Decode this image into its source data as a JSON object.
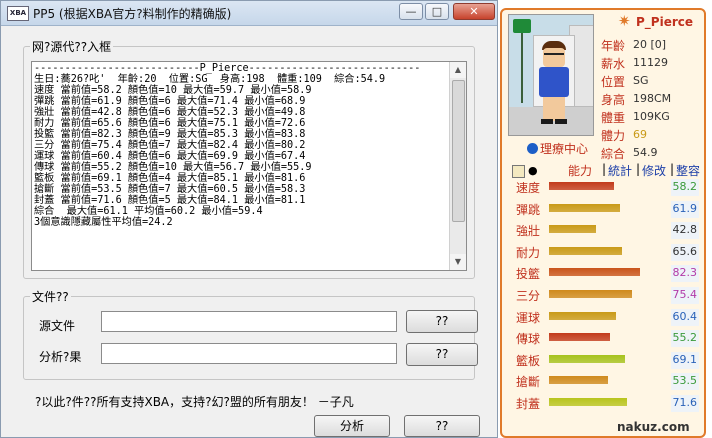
{
  "window": {
    "app_icon": "XBA",
    "title": "PP5 (根据XBA官方?料制作的精确版)",
    "min": "—",
    "max": "□",
    "close": "✕"
  },
  "source_group": {
    "legend": "网?源代??入框",
    "lines": [
      "---------------------------P_Pierce----------------------------",
      "生日:蕎26?叱'  年齡:20  位置:SG  身高:198  體重:109  綜合:54.9",
      "速度 當前值=58.2 顏色值=10 最大值=59.7 最小值=58.9",
      "彈跳 當前值=61.9 顏色值=6 最大值=71.4 最小值=68.9",
      "強壯 當前值=42.8 顏色值=6 最大值=52.3 最小值=49.8",
      "耐力 當前值=65.6 顏色值=6 最大值=75.1 最小值=72.6",
      "投籃 當前值=82.3 顏色值=9 最大值=85.3 最小值=83.8",
      "三分 當前值=75.4 顏色值=7 最大值=82.4 最小值=80.2",
      "運球 當前值=60.4 顏色值=6 最大值=69.9 最小值=67.4",
      "傳球 當前值=55.2 顏色值=10 最大值=56.7 最小值=55.9",
      "籃板 當前值=69.1 顏色值=4 最大值=85.1 最小值=81.6",
      "搶斷 當前值=53.5 顏色值=7 最大值=60.5 最小值=58.3",
      "封蓋 當前值=71.6 顏色值=5 最大值=84.1 最小值=81.1",
      "綜合  最大值=61.1 平均值=60.2 最小值=59.4",
      "3個意識隱藏屬性平均值=24.2"
    ]
  },
  "file_group": {
    "legend": "文件??",
    "source_label": "源文件",
    "source_value": "",
    "source_browse": "??",
    "result_label": "分析?果",
    "result_value": "",
    "result_browse": "??"
  },
  "footer": {
    "note": "?以此?件??所有支持XBA，支持?幻?盟的所有朋友！    －子凡",
    "analyze": "分析",
    "other": "??"
  },
  "player": {
    "name": "P_Pierce",
    "info": [
      {
        "key": "年齡",
        "value": "20 [0]"
      },
      {
        "key": "薪水",
        "value": "11129"
      },
      {
        "key": "位置",
        "value": "SG"
      },
      {
        "key": "身高",
        "value": "198CM"
      },
      {
        "key": "體重",
        "value": "109KG"
      },
      {
        "key": "體力",
        "value": "69"
      },
      {
        "key": "綜合",
        "value": "54.9"
      }
    ],
    "tag": "理療中心",
    "tabs": {
      "ability": "能力",
      "stats": "統計",
      "edit": "修改",
      "tidy": "整容"
    },
    "stats": [
      {
        "key": "速度",
        "value": "58.2",
        "fill": 0.66,
        "color": "#c23a1a"
      },
      {
        "key": "彈跳",
        "value": "61.9",
        "fill": 0.72,
        "color": "#c99a17"
      },
      {
        "key": "強壯",
        "value": "42.8",
        "fill": 0.48,
        "color": "#c99a17"
      },
      {
        "key": "耐力",
        "value": "65.6",
        "fill": 0.74,
        "color": "#c99a17"
      },
      {
        "key": "投籃",
        "value": "82.3",
        "fill": 0.93,
        "color": "#c9541a"
      },
      {
        "key": "三分",
        "value": "75.4",
        "fill": 0.85,
        "color": "#cf8a1c"
      },
      {
        "key": "運球",
        "value": "60.4",
        "fill": 0.68,
        "color": "#c99a17"
      },
      {
        "key": "傳球",
        "value": "55.2",
        "fill": 0.62,
        "color": "#c23a1a"
      },
      {
        "key": "籃板",
        "value": "69.1",
        "fill": 0.78,
        "color": "#a6c21c"
      },
      {
        "key": "搶斷",
        "value": "53.5",
        "fill": 0.6,
        "color": "#cf8a1c"
      },
      {
        "key": "封蓋",
        "value": "71.6",
        "fill": 0.8,
        "color": "#b8c41c"
      }
    ],
    "value_colors": {
      "58.2": "#3a9a3a",
      "61.9": "#2a62b8",
      "42.8": "#333333",
      "65.6": "#333333",
      "82.3": "#b23aa8",
      "75.4": "#b23aa8",
      "60.4": "#2a62b8",
      "55.2": "#3a9a3a",
      "69.1": "#2a62b8",
      "53.5": "#3a9a3a",
      "71.6": "#2a62b8"
    }
  },
  "watermark": "nakuz.com"
}
